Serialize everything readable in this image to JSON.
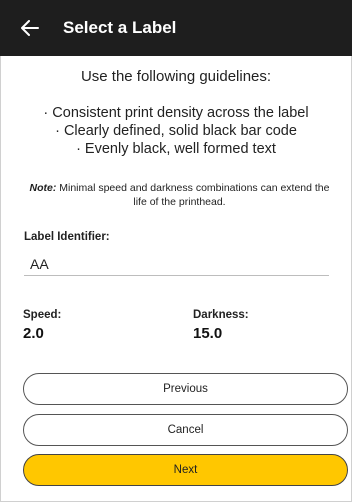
{
  "app_bar": {
    "title": "Select a Label",
    "back_icon": "arrow-left-icon"
  },
  "guidelines": {
    "heading": "Use the following guidelines:",
    "items": [
      "· Consistent print density across the label",
      "· Clearly defined, solid black bar code",
      "· Evenly black, well formed text"
    ]
  },
  "note": {
    "label": "Note:",
    "text": " Minimal speed and darkness combinations can extend the life of the printhead."
  },
  "label_identifier": {
    "caption": "Label Identifier:",
    "value": "AA"
  },
  "speed": {
    "caption": "Speed:",
    "value": "2.0"
  },
  "darkness": {
    "caption": "Darkness:",
    "value": "15.0"
  },
  "buttons": {
    "previous": "Previous",
    "cancel": "Cancel",
    "next": "Next"
  },
  "colors": {
    "app_bar": "#1e1e1e",
    "primary_button": "#ffc700"
  }
}
